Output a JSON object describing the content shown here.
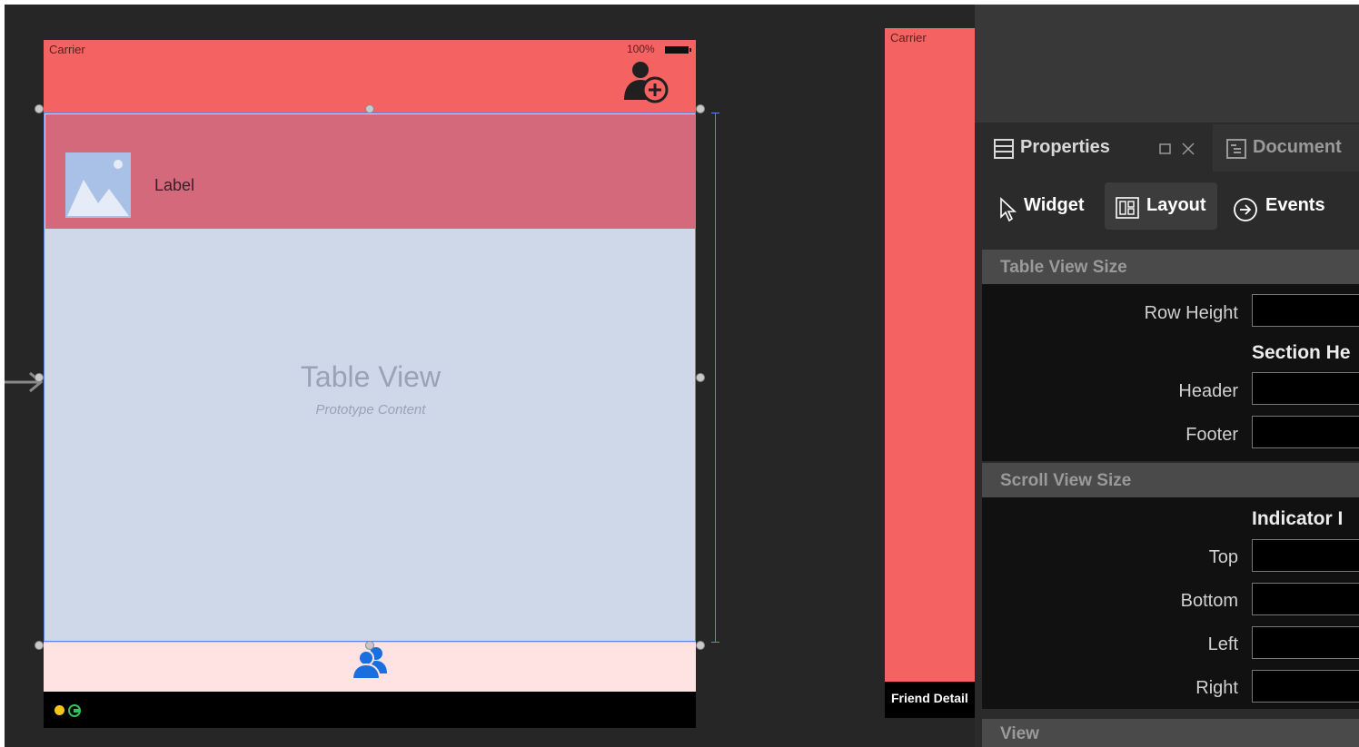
{
  "scene1": {
    "carrier": "Carrier",
    "battery": "100%",
    "cell_label": "Label",
    "table_title": "Table View",
    "table_subtitle": "Prototype Content"
  },
  "scene2": {
    "carrier": "Carrier",
    "dock_title": "Friend Detail"
  },
  "panel": {
    "tabs": [
      {
        "label": "Properties",
        "icon": "properties-icon"
      },
      {
        "label": "Document",
        "icon": "document-icon"
      }
    ],
    "subtabs": [
      {
        "label": "Widget",
        "icon": "pointer-icon",
        "active": false
      },
      {
        "label": "Layout",
        "icon": "layout-icon",
        "active": true
      },
      {
        "label": "Events",
        "icon": "arrow-circle-icon",
        "active": false
      }
    ],
    "sections": {
      "table_view_size": {
        "title": "Table View Size",
        "row_height": "Row Height",
        "group": "Section He",
        "header": "Header",
        "footer": "Footer"
      },
      "scroll_view_size": {
        "title": "Scroll View Size",
        "group": "Indicator I",
        "top": "Top",
        "bottom": "Bottom",
        "left": "Left",
        "right": "Right"
      },
      "view": {
        "title": "View"
      }
    }
  },
  "colors": {
    "nav_red": "#f56262",
    "cell_pink": "#d5697c",
    "table_bg": "#cfd8e8",
    "selection_blue": "#5a84e8",
    "tabbar_pink": "#ffe3e3",
    "icon_blue": "#1a6fe0"
  }
}
